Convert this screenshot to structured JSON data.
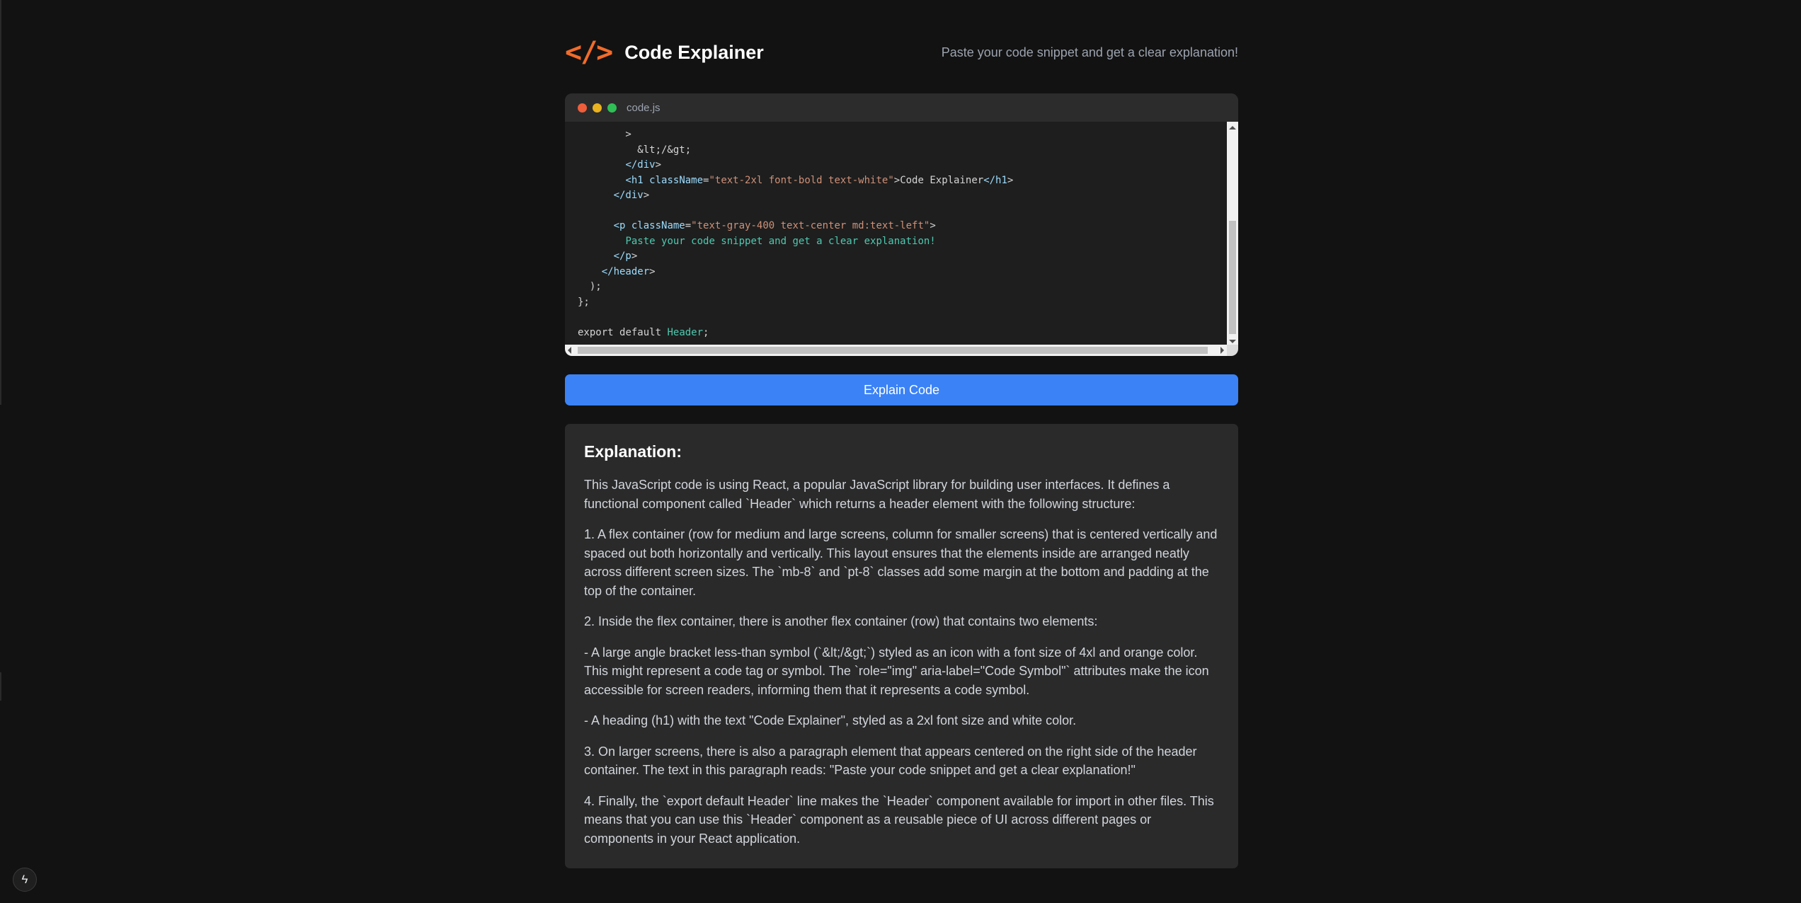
{
  "header": {
    "icon": "</>",
    "icon_name": "code-symbol-icon",
    "title": "Code Explainer",
    "tagline": "Paste your code snippet and get a clear explanation!"
  },
  "editor": {
    "filename": "code.js",
    "lines": [
      "        >",
      "          &lt;/&gt;",
      "        </div>",
      "        <h1 className=\"text-2xl font-bold text-white\">Code Explainer</h1>",
      "      </div>",
      "",
      "      <p className=\"text-gray-400 text-center md:text-left\">",
      "        Paste your code snippet and get a clear explanation!",
      "      </p>",
      "    </header>",
      "  );",
      "};",
      "",
      "export default Header;"
    ]
  },
  "explain_button": {
    "label": "Explain Code"
  },
  "explanation": {
    "heading": "Explanation:",
    "paragraphs": [
      "This JavaScript code is using React, a popular JavaScript library for building user interfaces. It defines a functional component called `Header` which returns a header element with the following structure:",
      "1. A flex container (row for medium and large screens, column for smaller screens) that is centered vertically and spaced out both horizontally and vertically. This layout ensures that the elements inside are arranged neatly across different screen sizes. The `mb-8` and `pt-8` classes add some margin at the bottom and padding at the top of the container.",
      "2. Inside the flex container, there is another flex container (row) that contains two elements:",
      "- A large angle bracket less-than symbol (`&lt;/&gt;`) styled as an icon with a font size of 4xl and orange color. This might represent a code tag or symbol. The `role=\"img\" aria-label=\"Code Symbol\"` attributes make the icon accessible for screen readers, informing them that it represents a code symbol.",
      "- A heading (h1) with the text \"Code Explainer\", styled as a 2xl font size and white color.",
      "3. On larger screens, there is also a paragraph element that appears centered on the right side of the header container. The text in this paragraph reads: \"Paste your code snippet and get a clear explanation!\"",
      "4. Finally, the `export default Header` line makes the `Header` component available for import in other files. This means that you can use this `Header` component as a reusable piece of UI across different pages or components in your React application."
    ]
  },
  "colors": {
    "accent_orange": "#f26b2a",
    "button_blue": "#3b82f6",
    "background": "#121212"
  },
  "dev_indicator": {
    "icon_name": "lightning-bolt-icon",
    "glyph": "ϟ"
  }
}
